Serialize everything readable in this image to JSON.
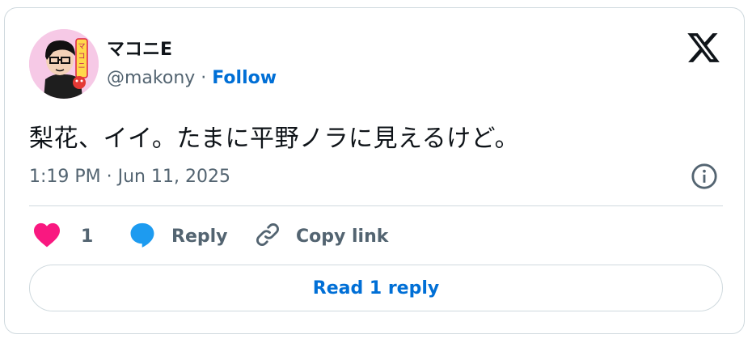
{
  "author": {
    "display_name": "マコニE",
    "handle": "@makony",
    "separator": "·",
    "follow_label": "Follow",
    "avatar_text": "マコニE"
  },
  "tweet": {
    "text": "梨花、イイ。たまに平野ノラに見えるけど。",
    "timestamp": "1:19 PM · Jun 11, 2025"
  },
  "actions": {
    "like_count": "1",
    "reply_label": "Reply",
    "copy_label": "Copy link"
  },
  "read_replies_label": "Read 1 reply",
  "colors": {
    "like": "#f91880",
    "reply": "#1d9bf0",
    "link": "#006fd6",
    "muted": "#536471",
    "border": "#cfd9de"
  },
  "icons": {
    "logo": "x-logo-icon",
    "info": "info-icon",
    "like": "heart-icon",
    "reply": "speech-bubble-icon",
    "copy": "link-icon"
  }
}
